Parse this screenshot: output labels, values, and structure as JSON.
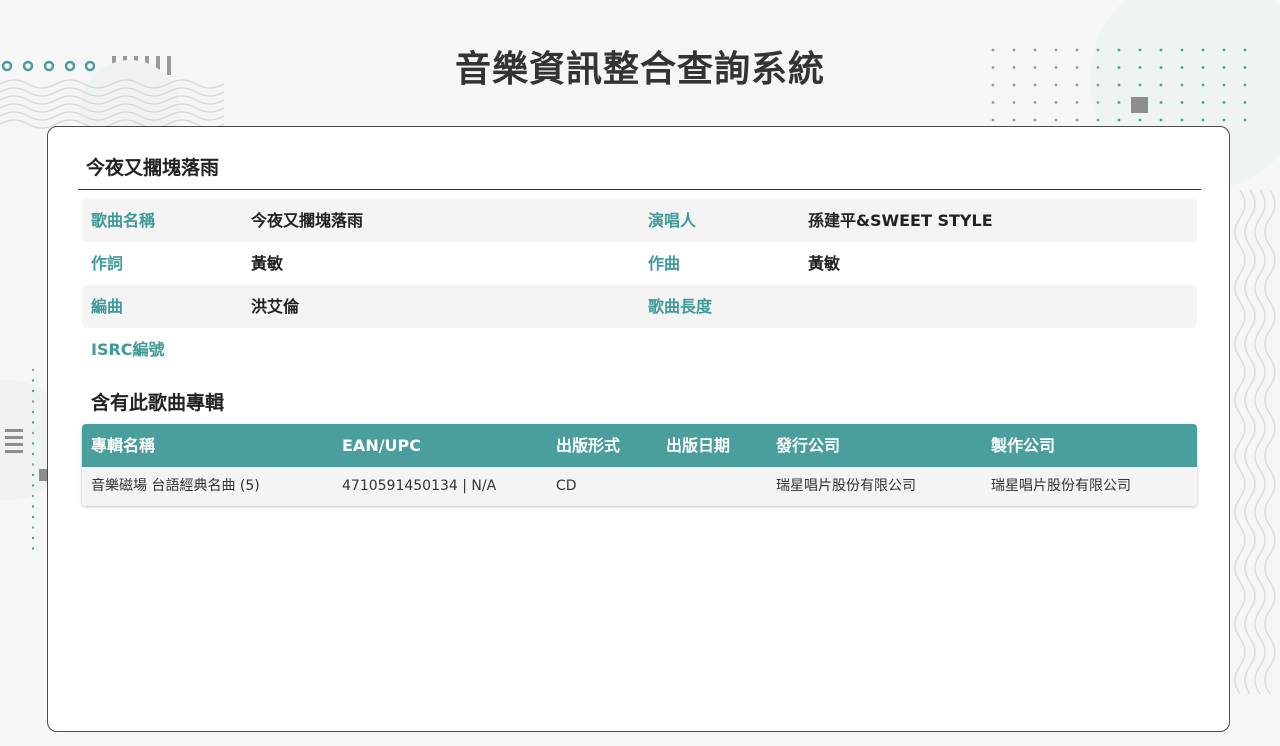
{
  "app": {
    "title": "音樂資訊整合查詢系統"
  },
  "song": {
    "heading": "今夜又擱塊落雨",
    "fields": {
      "title_label": "歌曲名稱",
      "title_value": "今夜又擱塊落雨",
      "singer_label": "演唱人",
      "singer_value": "孫建平&SWEET STYLE",
      "lyricist_label": "作詞",
      "lyricist_value": "黃敏",
      "composer_label": "作曲",
      "composer_value": "黃敏",
      "arranger_label": "編曲",
      "arranger_value": "洪艾倫",
      "length_label": "歌曲長度",
      "length_value": "",
      "isrc_label": "ISRC編號",
      "isrc_value": ""
    }
  },
  "albums": {
    "heading": "含有此歌曲專輯",
    "columns": [
      "專輯名稱",
      "EAN/UPC",
      "出版形式",
      "出版日期",
      "發行公司",
      "製作公司"
    ],
    "rows": [
      [
        "音樂磁場 台語經典名曲 (5)",
        "4710591450134 | N/A",
        "CD",
        "",
        "瑞星唱片股份有限公司",
        "瑞星唱片股份有限公司"
      ]
    ]
  },
  "colors": {
    "accent": "#4a9e9c",
    "label": "#3f9a98",
    "background": "#f6f6f6"
  }
}
